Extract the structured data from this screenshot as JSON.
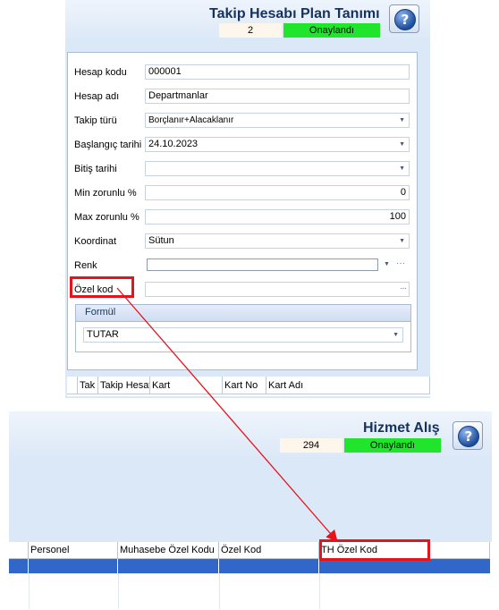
{
  "top_window": {
    "title": "Takip Hesabı Plan Tanımı",
    "record_number": "2",
    "status": "Onaylandı",
    "help_icon": "question-mark-icon",
    "form": {
      "fields": [
        {
          "label": "Hesap kodu",
          "value": "000001",
          "control": "text"
        },
        {
          "label": "Hesap adı",
          "value": "Departmanlar",
          "control": "text"
        },
        {
          "label": "Takip türü",
          "value": "Borçlanır+Alacaklanır",
          "control": "dropdown"
        },
        {
          "label": "Başlangıç tarihi",
          "value": "24.10.2023",
          "control": "date"
        },
        {
          "label": "Bitiş tarihi",
          "value": "",
          "control": "date"
        },
        {
          "label": "Min zorunlu %",
          "value": "0",
          "control": "number"
        },
        {
          "label": "Max zorunlu %",
          "value": "100",
          "control": "number"
        },
        {
          "label": "Koordinat",
          "value": "Sütun",
          "control": "dropdown"
        },
        {
          "label": "Renk",
          "value": "",
          "control": "color"
        },
        {
          "label": "Özel kod",
          "value": "",
          "control": "ellipsis"
        }
      ],
      "formul_group": {
        "title": "Formül",
        "value": "TUTAR"
      }
    },
    "grid_columns": [
      "Tak",
      "Takip Hesat",
      "Kart",
      "Kart No",
      "Kart Adı"
    ]
  },
  "bottom_window": {
    "title": "Hizmet Alış",
    "record_number": "294",
    "status": "Onaylandı",
    "help_icon": "question-mark-icon",
    "grid_columns": [
      "Personel",
      "Muhasebe Özel Kodu",
      "Özel Kod",
      "TH Özel Kod"
    ]
  },
  "annotation": {
    "color": "#e8121a"
  },
  "colors": {
    "status_green": "#20e52c",
    "selection_blue": "#3167c9",
    "title_navy": "#15325e"
  }
}
